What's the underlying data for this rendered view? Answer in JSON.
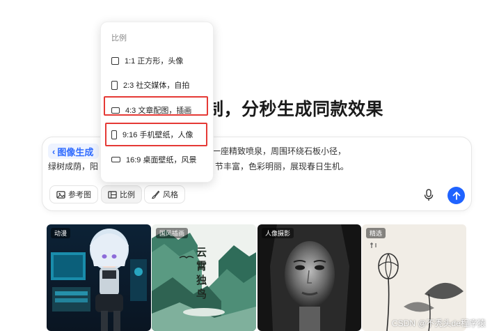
{
  "heading_visible": "制，分秒生成同款效果",
  "composer": {
    "mode_tag": "图像生成",
    "prompt_line1": "的郁金香与樱花交织，中央是一座精致喷泉，周围环绕石板小径，",
    "prompt_line2": "绿树成荫，阳",
    "prompt_line2_tail": "节丰富，色彩明丽，展现春日生机。",
    "tools": {
      "reference": "参考图",
      "ratio": "比例",
      "style": "风格"
    }
  },
  "ratio_dropdown": {
    "title": "比例",
    "options": [
      {
        "label": "1:1 正方形，头像",
        "icon": "square-ratio-icon"
      },
      {
        "label": "2:3 社交媒体，自拍",
        "icon": "portrait-2-3-icon"
      },
      {
        "label": "4:3 文章配图，插画",
        "icon": "landscape-4-3-icon"
      },
      {
        "label": "9:16 手机壁纸，人像",
        "icon": "portrait-9-16-icon"
      },
      {
        "label": "16:9 桌面壁纸，风景",
        "icon": "landscape-16-9-icon"
      }
    ]
  },
  "gallery": [
    {
      "tag": "动漫",
      "kind": "anime-cyber-girl"
    },
    {
      "tag": "国风插画",
      "kind": "ink-landscape",
      "calligraphy": "云霄独鸟"
    },
    {
      "tag": "人像摄影",
      "kind": "bw-portrait"
    },
    {
      "tag": "精选",
      "kind": "ink-lotus"
    }
  ],
  "watermark": "CSDN @不秃头de程序猿",
  "colors": {
    "accent": "#1f63ff",
    "highlight": "#e53935"
  }
}
